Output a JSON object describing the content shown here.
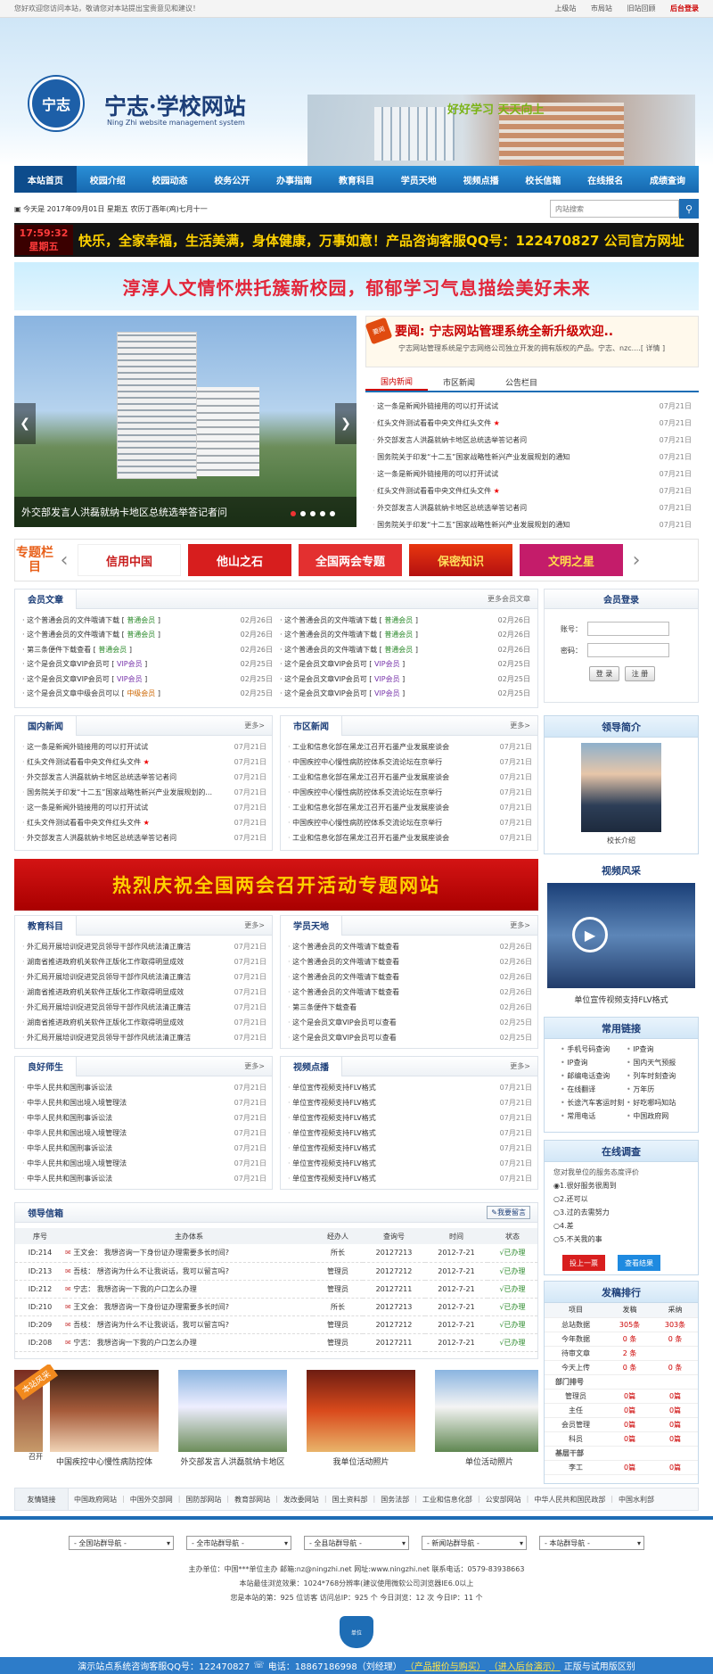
{
  "topbar": {
    "welcome": "您好欢迎您访问本站，敬请您对本站提出宝贵意见和建议！",
    "links": [
      "上级站",
      "市局站",
      "旧站回顾",
      "后台登录"
    ]
  },
  "brand": {
    "name": "宁志·学校网站",
    "en": "Ning Zhi website management system",
    "logo_text": "宁志",
    "slogan": "好好学习 天天向上"
  },
  "nav": [
    "本站首页",
    "校园介绍",
    "校园动态",
    "校务公开",
    "办事指南",
    "教育科目",
    "学员天地",
    "视频点播",
    "校长信箱",
    "在线报名",
    "成绩查询"
  ],
  "date": "今天是 2017年09月01日  星期五  农历丁酉年(鸡)七月十一",
  "search_placeholder": "内站搜索",
  "ticker": {
    "time": "17:59:32",
    "weekday": "星期五",
    "text": "快乐，全家幸福，生活美满，身体健康，万事如意！产品咨询客服QQ号：122470827 公司官方网址"
  },
  "banner_text": "淳淳人文情怀烘托簇新校园，郁郁学习气息描绘美好未来",
  "slider": {
    "caption": "外交部发言人洪磊就纳卡地区总统选举答记者问"
  },
  "headline": {
    "label": "要闻",
    "title": "要闻: 宁志网站管理系统全新升级欢迎..",
    "desc": "宁志网站管理系统是宁志网络公司独立开发的拥有版权的产品。宁志、nzc....[ 详情 ]"
  },
  "news_tabs": [
    "国内新闻",
    "市区新闻",
    "公告栏目"
  ],
  "news": [
    [
      "这一条是新闻外链接用的可以打开试试",
      "07月21日",
      false
    ],
    [
      "红头文件测试看看中央文件红头文件",
      "07月21日",
      true
    ],
    [
      "外交部发言人洪磊就纳卡地区总统选举答记者问",
      "07月21日",
      false
    ],
    [
      "国务院关于印发“十二五”国家战略性新兴产业发展规划的通知",
      "07月21日",
      false
    ],
    [
      "这一条是新闻外链接用的可以打开试试",
      "07月21日",
      false
    ],
    [
      "红头文件测试看看中央文件红头文件",
      "07月21日",
      true
    ],
    [
      "外交部发言人洪磊就纳卡地区总统选举答记者问",
      "07月21日",
      false
    ],
    [
      "国务院关于印发“十二五”国家战略性新兴产业发展规划的通知",
      "07月21日",
      false
    ]
  ],
  "special": {
    "title": "专题栏目",
    "items": [
      "信用中国",
      "他山之石",
      "全国两会专题",
      "保密知识",
      "文明之星"
    ]
  },
  "member": {
    "title": "会员文章",
    "more": "更多会员文章",
    "left": [
      [
        "这个普通会员的文件哦请下载",
        "普通会员",
        "02月26日"
      ],
      [
        "这个普通会员的文件哦请下载",
        "普通会员",
        "02月26日"
      ],
      [
        "第三条便件下载查看",
        "普通会员",
        "02月26日"
      ],
      [
        "这个是会员文章VIP会员可",
        "VIP会员",
        "02月25日"
      ],
      [
        "这个是会员文章VIP会员可",
        "VIP会员",
        "02月25日"
      ],
      [
        "这个是会员文章中级会员可以",
        "中级会员",
        "02月25日"
      ]
    ],
    "right": [
      [
        "这个普通会员的文件哦请下载",
        "普通会员",
        "02月26日"
      ],
      [
        "这个普通会员的文件哦请下载",
        "普通会员",
        "02月26日"
      ],
      [
        "这个普通会员的文件哦请下载",
        "普通会员",
        "02月26日"
      ],
      [
        "这个是会员文章VIP会员可",
        "VIP会员",
        "02月25日"
      ],
      [
        "这个是会员文章VIP会员可",
        "VIP会员",
        "02月25日"
      ],
      [
        "这个是会员文章VIP会员可",
        "VIP会员",
        "02月25日"
      ]
    ]
  },
  "login": {
    "title": "会员登录",
    "user": "账号：",
    "pass": "密码：",
    "btn_login": "登 录",
    "btn_reg": "注 册"
  },
  "box_domestic": {
    "title": "国内新闻",
    "more": "更多>",
    "items": [
      [
        "这一条是新闻外链接用的可以打开试试",
        "07月21日"
      ],
      [
        "红头文件测试看看中央文件红头文件",
        "07月21日"
      ],
      [
        "外交部发言人洪磊就纳卡地区总统选举答记者问",
        "07月21日"
      ],
      [
        "国务院关于印发“十二五”国家战略性新兴产业发展规划的...",
        "07月21日"
      ],
      [
        "这一条是新闻外链接用的可以打开试试",
        "07月21日"
      ],
      [
        "红头文件测试看看中央文件红头文件",
        "07月21日"
      ],
      [
        "外交部发言人洪磊就纳卡地区总统选举答记者问",
        "07月21日"
      ]
    ]
  },
  "box_city": {
    "title": "市区新闻",
    "more": "更多>",
    "items": [
      [
        "工业和信息化部在黑龙江召开石墨产业发展座谈会",
        "07月21日"
      ],
      [
        "中国疾控中心慢性病防控体系交流论坛在京举行",
        "07月21日"
      ],
      [
        "工业和信息化部在黑龙江召开石墨产业发展座谈会",
        "07月21日"
      ],
      [
        "中国疾控中心慢性病防控体系交流论坛在京举行",
        "07月21日"
      ],
      [
        "工业和信息化部在黑龙江召开石墨产业发展座谈会",
        "07月21日"
      ],
      [
        "中国疾控中心慢性病防控体系交流论坛在京举行",
        "07月21日"
      ],
      [
        "工业和信息化部在黑龙江召开石墨产业发展座谈会",
        "07月21日"
      ]
    ]
  },
  "leader": {
    "title": "领导简介",
    "caption": "校长介绍"
  },
  "red_banner": "热烈庆祝全国两会召开活动专题网站",
  "video_side": {
    "title": "视频风采",
    "caption": "单位宣传视频支持FLV格式"
  },
  "box_edu": {
    "title": "教育科目",
    "more": "更多>",
    "items": [
      [
        "外汇局开展培训促进党员领导干部作风统法清正廉洁",
        "07月21日"
      ],
      [
        "湖南省推进政府机关软件正版化工作取得明显成效",
        "07月21日"
      ],
      [
        "外汇局开展培训促进党员领导干部作风统法清正廉洁",
        "07月21日"
      ],
      [
        "湖南省推进政府机关软件正版化工作取得明显成效",
        "07月21日"
      ],
      [
        "外汇局开展培训促进党员领导干部作风统法清正廉洁",
        "07月21日"
      ],
      [
        "湖南省推进政府机关软件正版化工作取得明显成效",
        "07月21日"
      ],
      [
        "外汇局开展培训促进党员领导干部作风统法清正廉洁",
        "07月21日"
      ]
    ]
  },
  "box_student": {
    "title": "学员天地",
    "more": "更多>",
    "items": [
      [
        "这个普通会员的文件哦请下载查看",
        "02月26日"
      ],
      [
        "这个普通会员的文件哦请下载查看",
        "02月26日"
      ],
      [
        "这个普通会员的文件哦请下载查看",
        "02月26日"
      ],
      [
        "这个普通会员的文件哦请下载查看",
        "02月26日"
      ],
      [
        "第三条便件下载查看",
        "02月26日"
      ],
      [
        "这个是会员文章VIP会员可以查看",
        "02月25日"
      ],
      [
        "这个是会员文章VIP会员可以查看",
        "02月25日"
      ]
    ]
  },
  "links_side": {
    "title": "常用链接",
    "items": [
      "手机号码查询",
      "IP查询",
      "IP查询",
      "国内天气预报",
      "邮编电话查询",
      "列车时刻查询",
      "在线翻译",
      "万年历",
      "长途汽车客运时刻",
      "好吃哪吗知站",
      "常用电话",
      "中国政府网"
    ]
  },
  "box_teacher": {
    "title": "良好师生",
    "more": "更多>",
    "items": [
      [
        "中华人民共和国刑事诉讼法",
        "07月21日"
      ],
      [
        "中华人民共和国出境入境管理法",
        "07月21日"
      ],
      [
        "中华人民共和国刑事诉讼法",
        "07月21日"
      ],
      [
        "中华人民共和国出境入境管理法",
        "07月21日"
      ],
      [
        "中华人民共和国刑事诉讼法",
        "07月21日"
      ],
      [
        "中华人民共和国出境入境管理法",
        "07月21日"
      ],
      [
        "中华人民共和国刑事诉讼法",
        "07月21日"
      ]
    ]
  },
  "box_video": {
    "title": "视频点播",
    "more": "更多>",
    "items": [
      [
        "单位宣传视频支持FLV格式",
        "07月21日"
      ],
      [
        "单位宣传视频支持FLV格式",
        "07月21日"
      ],
      [
        "单位宣传视频支持FLV格式",
        "07月21日"
      ],
      [
        "单位宣传视频支持FLV格式",
        "07月21日"
      ],
      [
        "单位宣传视频支持FLV格式",
        "07月21日"
      ],
      [
        "单位宣传视频支持FLV格式",
        "07月21日"
      ],
      [
        "单位宣传视频支持FLV格式",
        "07月21日"
      ]
    ]
  },
  "survey": {
    "title": "在线调查",
    "question": "您对我单位的服务态度评价",
    "options": [
      "1.很好服务很周到",
      "2.还可以",
      "3.过的去需努力",
      "4.差",
      "5.不关我的事"
    ],
    "vote": "投上一票",
    "result": "查看结果"
  },
  "mailbox": {
    "title": "领导信箱",
    "btn": "我要留言",
    "headers": [
      "序号",
      "主办体系",
      "经办人",
      "查询号",
      "时间",
      "状态"
    ],
    "rows": [
      [
        "ID:214",
        "王文会：",
        "我想咨询一下身份证办理需要多长时间?",
        "所长",
        "20127213",
        "2012-7-21",
        "√已办理"
      ],
      [
        "ID:213",
        "吾枝：",
        "想咨询为什么不让我说话，我可以留言吗?",
        "管理员",
        "20127212",
        "2012-7-21",
        "√已办理"
      ],
      [
        "ID:212",
        "宁志：",
        "我想咨询一下我的户口怎么办理",
        "管理员",
        "20127211",
        "2012-7-21",
        "√已办理"
      ],
      [
        "ID:210",
        "王文会：",
        "我想咨询一下身份证办理需要多长时间?",
        "所长",
        "20127213",
        "2012-7-21",
        "√已办理"
      ],
      [
        "ID:209",
        "吾枝：",
        "想咨询为什么不让我说话，我可以留言吗?",
        "管理员",
        "20127212",
        "2012-7-21",
        "√已办理"
      ],
      [
        "ID:208",
        "宁志：",
        "我想咨询一下我的户口怎么办理",
        "管理员",
        "20127211",
        "2012-7-21",
        "√已办理"
      ]
    ]
  },
  "stats": {
    "title": "发稿排行",
    "headers": [
      "项目",
      "发稿",
      "采纳"
    ],
    "rows": [
      [
        "总站数据",
        "305条",
        "303条"
      ],
      [
        "今年数据",
        "0 条",
        "0 条"
      ],
      [
        "待审文章",
        "2 条",
        ""
      ],
      [
        "今天上传",
        "0 条",
        "0 条"
      ]
    ],
    "section1": "部门排号",
    "dept": [
      [
        "管理员",
        "0篇",
        "0篇"
      ],
      [
        "主任",
        "0篇",
        "0篇"
      ],
      [
        "会员管理",
        "0篇",
        "0篇"
      ],
      [
        "科员",
        "0篇",
        "0篇"
      ]
    ],
    "section2": "基层干部",
    "base": [
      [
        "李工",
        "0篇",
        "0篇"
      ]
    ]
  },
  "photos": {
    "ribbon": "本站风采",
    "items": [
      "中国疾控中心慢性病防控体",
      "外交部发言人洪磊就纳卡地区",
      "我单位活动照片",
      "单位活动照片"
    ],
    "partial": "召开"
  },
  "friend_links": {
    "label": "友情链接",
    "items": [
      "中国政府网站",
      "中国外交部网",
      "国防部网站",
      "教育部网站",
      "发改委网站",
      "国土资料部",
      "国务法部",
      "工业和信息化部",
      "公安部网站",
      "中华人民共和国民政部",
      "中国水利部"
    ]
  },
  "selects": [
    "- 全国站群导航 -",
    "- 全市站群导航 -",
    "- 全县站群导航 -",
    "- 新闻站群导航 -",
    "- 本站群导航 -"
  ],
  "footer": {
    "l1": "主办单位：中国***单位主办  邮箱:nz@ningzhi.net  网址:www.ningzhi.net  联系电话：0579-83938663",
    "l2": "本站最佳浏览效果：1024*768分辨率(建议使用微软公司浏览器IE6.0以上",
    "l3": "您是本站的第：925 位访客   访问总IP：925 个   今日浏览：12 次   今日IP：11 个",
    "badge": "单位"
  },
  "bottombar": {
    "a": "演示站点系统咨询客服QQ号：122470827",
    "b": "电话：18867186998（刘经理）",
    "c": "（产品报价与购买）",
    "d": "（进入后台演示）",
    "e": "正版与试用版区别"
  }
}
